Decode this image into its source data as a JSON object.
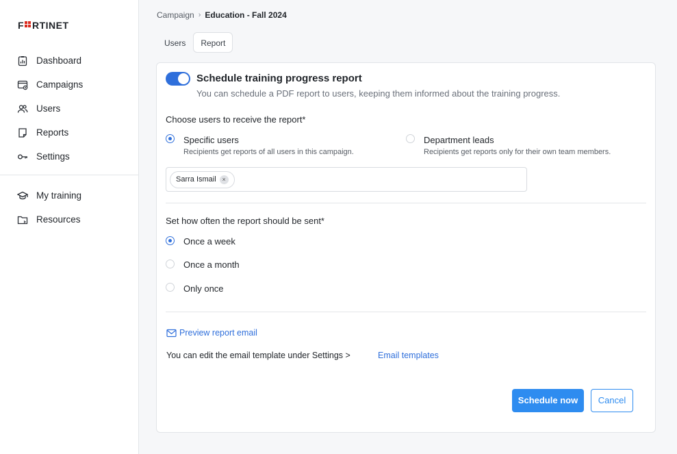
{
  "brand": {
    "logo_text": "FORTINET",
    "logo_color": "#1f2328",
    "logo_accent": "#da291c"
  },
  "sidebar": {
    "primary_items": [
      {
        "label": "Dashboard",
        "icon": "dashboard-icon"
      },
      {
        "label": "Campaigns",
        "icon": "campaigns-icon"
      },
      {
        "label": "Users",
        "icon": "users-icon"
      },
      {
        "label": "Reports",
        "icon": "reports-icon"
      },
      {
        "label": "Settings",
        "icon": "settings-icon"
      }
    ],
    "secondary_items": [
      {
        "label": "My training",
        "icon": "graduation-cap-icon"
      },
      {
        "label": "Resources",
        "icon": "folder-icon"
      }
    ]
  },
  "breadcrumb": {
    "parent": "Campaign",
    "separator": "›",
    "current": "Education - Fall 2024"
  },
  "tabs": [
    {
      "label": "Users",
      "active": false
    },
    {
      "label": "Report",
      "active": true
    }
  ],
  "report": {
    "toggle_on": true,
    "title": "Schedule training progress report",
    "subtitle": "You can schedule a PDF report to users, keeping them informed about the training progress.",
    "recipients": {
      "label": "Choose users to receive the report*",
      "options": [
        {
          "label": "Specific users",
          "description": "Recipients get reports of all users in this campaign.",
          "checked": true
        },
        {
          "label": "Department leads",
          "description": "Recipients get reports only for their own team members.",
          "checked": false
        }
      ],
      "selected_users": [
        "Sarra Ismail"
      ],
      "chip_remove": "×"
    },
    "frequency": {
      "label": "Set how often the report should be sent*",
      "options": [
        {
          "label": "Once a week",
          "checked": true
        },
        {
          "label": "Once a month",
          "checked": false
        },
        {
          "label": "Only once",
          "checked": false
        }
      ]
    },
    "preview_link": "Preview report email",
    "edit_text": "You can edit the email template under Settings >",
    "email_templates_link": "Email templates",
    "schedule_button": "Schedule now",
    "cancel_button": "Cancel"
  },
  "colors": {
    "accent": "#2f6fdb",
    "button_primary": "#2e8cf0"
  }
}
